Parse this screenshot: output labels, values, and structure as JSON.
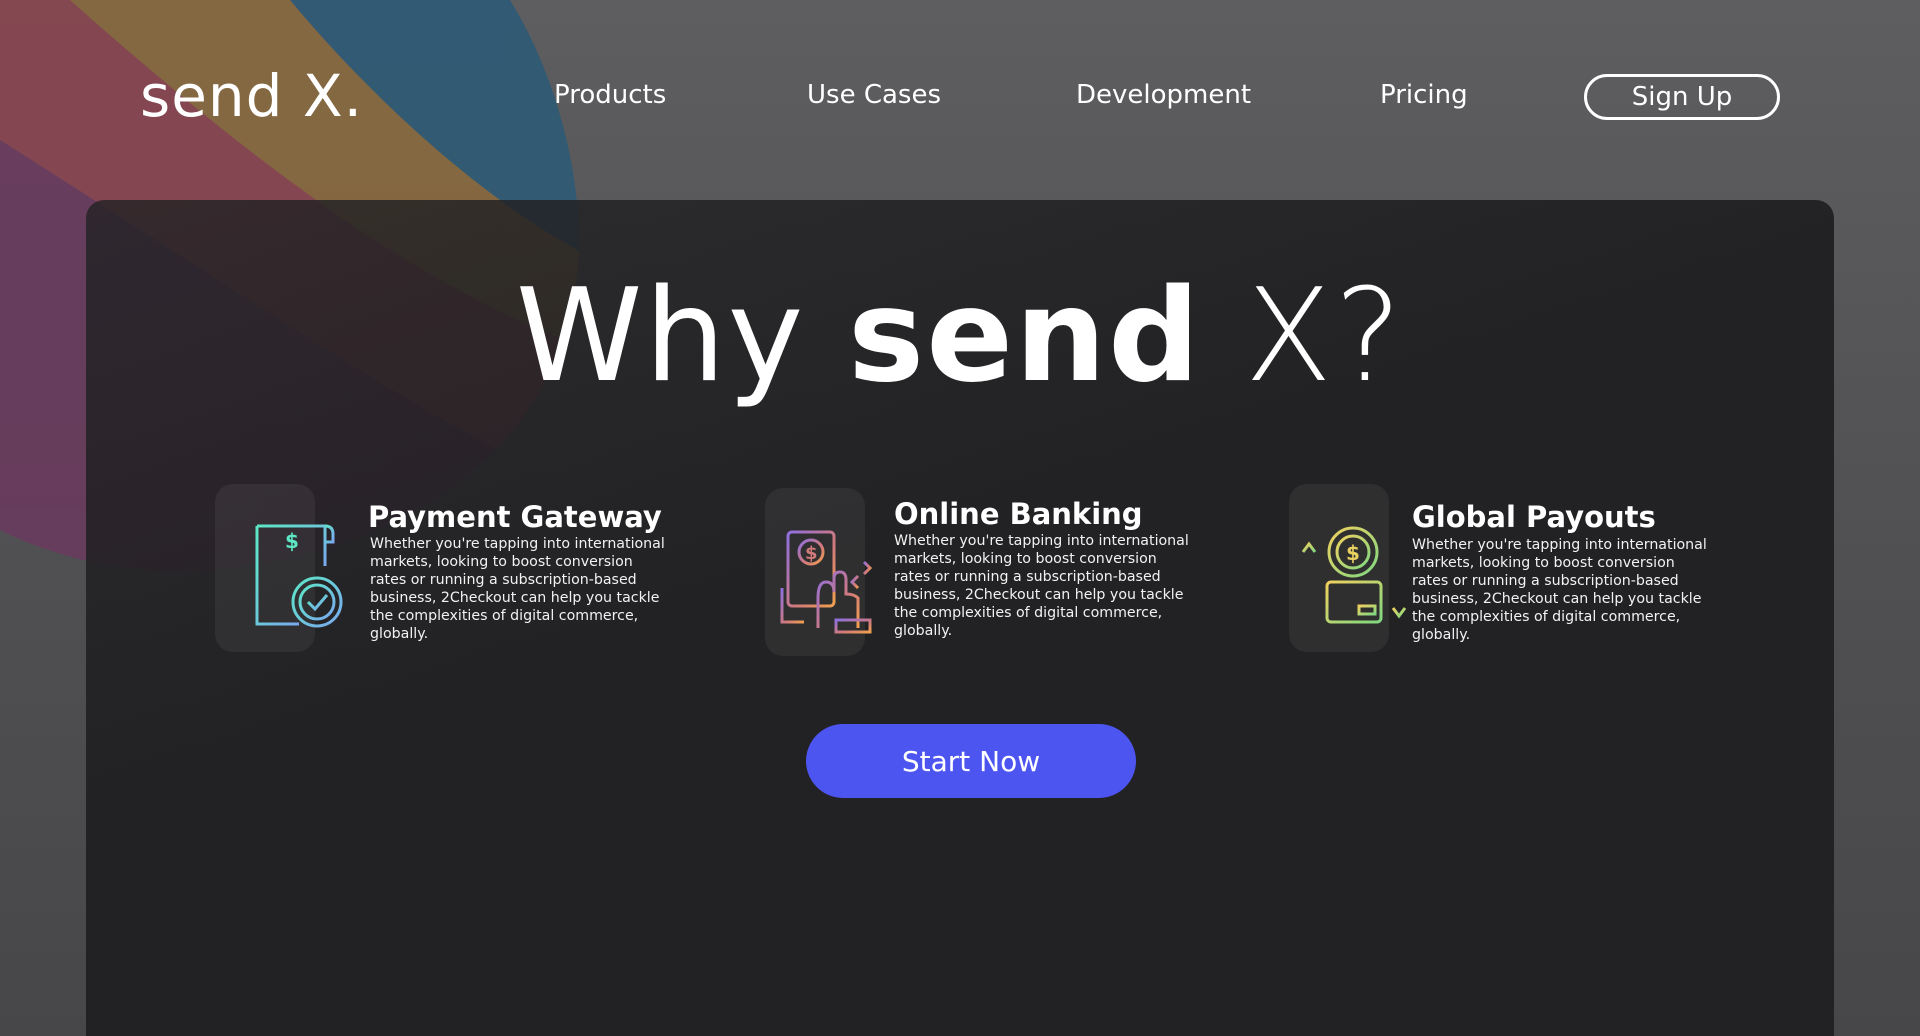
{
  "header": {
    "logo": "send X.",
    "nav": [
      "Products",
      "Use Cases",
      "Development",
      "Pricing"
    ],
    "signup_label": "Sign Up"
  },
  "hero": {
    "title_why": "Why",
    "title_send": "send",
    "title_x": "X?"
  },
  "features": [
    {
      "title": "Payment Gateway",
      "description": "Whether you're tapping into international markets, looking to boost conversion rates or running a subscription-based business, 2Checkout can help you tackle the complexities of digital commerce, globally.",
      "icon": "invoice-check-icon"
    },
    {
      "title": "Online Banking",
      "description": "Whether you're tapping into international markets, looking to boost conversion rates or running a subscription-based business, 2Checkout can help you tackle the complexities of digital commerce, globally.",
      "icon": "mobile-payment-icon"
    },
    {
      "title": "Global Payouts",
      "description": "Whether you're tapping into international markets, looking to boost conversion rates or running a subscription-based business, 2Checkout can help you tackle the complexities of digital commerce, globally.",
      "icon": "coin-card-transfer-icon"
    }
  ],
  "cta": {
    "label": "Start Now"
  },
  "colors": {
    "accent": "#4d55f0",
    "arc_blue": "#2e5a77",
    "arc_orange": "#8a6a3e",
    "arc_red": "#8a4550",
    "arc_purple": "#6a3a5e"
  }
}
